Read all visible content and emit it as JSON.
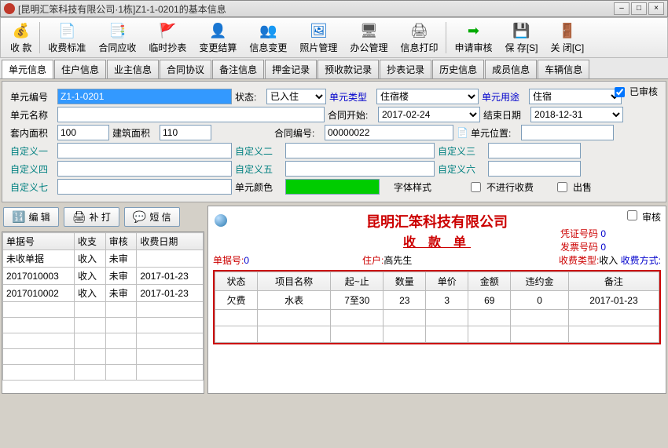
{
  "window": {
    "title": "[昆明汇笨科技有限公司·1栋]Z1-1-0201的基本信息"
  },
  "toolbar": [
    {
      "label": "收  款",
      "icon": "💰",
      "color": "#2a7"
    },
    {
      "label": "收费标准",
      "icon": "📄",
      "color": "#c33"
    },
    {
      "label": "合同应收",
      "icon": "📑",
      "color": "#06c"
    },
    {
      "label": "临时抄表",
      "icon": "🚩",
      "color": "#c33"
    },
    {
      "label": "变更结算",
      "icon": "👤",
      "color": "#f90"
    },
    {
      "label": "信息变更",
      "icon": "👥",
      "color": "#06c"
    },
    {
      "label": "照片管理",
      "icon": "🖼",
      "color": "#06c"
    },
    {
      "label": "办公管理",
      "icon": "🖥",
      "color": "#555"
    },
    {
      "label": "信息打印",
      "icon": "🖨",
      "color": "#555"
    },
    {
      "label": "申请审核",
      "icon": "➡",
      "color": "#0a0"
    },
    {
      "label": "保 存[S]",
      "icon": "💾",
      "color": "#339"
    },
    {
      "label": "关 闭[C]",
      "icon": "🚪",
      "color": "#c33"
    }
  ],
  "tabs": [
    "单元信息",
    "住户信息",
    "业主信息",
    "合同协议",
    "备注信息",
    "押金记录",
    "预收款记录",
    "抄表记录",
    "历史信息",
    "成员信息",
    "车辆信息"
  ],
  "active_tab": 0,
  "audited_label": "已审核",
  "form": {
    "unit_no": {
      "label": "单元编号",
      "value": "Z1-1-0201"
    },
    "state": {
      "label": "状态:",
      "value": "已入住"
    },
    "unit_type": {
      "label": "单元类型",
      "value": "住宿楼"
    },
    "unit_use": {
      "label": "单元用途",
      "value": "住宿"
    },
    "unit_name": {
      "label": "单元名称",
      "value": ""
    },
    "contract_start": {
      "label": "合同开始:",
      "value": "2017-02-24"
    },
    "end_date": {
      "label": "结束日期",
      "value": "2018-12-31"
    },
    "inner_area": {
      "label": "套内面积",
      "value": "100"
    },
    "build_area": {
      "label": "建筑面积",
      "value": "110"
    },
    "contract_no": {
      "label": "合同编号:",
      "value": "00000022"
    },
    "unit_pos": {
      "label": "单元位置:",
      "value": ""
    },
    "c1": {
      "label": "自定义一"
    },
    "c2": {
      "label": "自定义二"
    },
    "c3": {
      "label": "自定义三"
    },
    "c4": {
      "label": "自定义四"
    },
    "c5": {
      "label": "自定义五"
    },
    "c6": {
      "label": "自定义六"
    },
    "c7": {
      "label": "自定义七"
    },
    "unit_color": {
      "label": "单元颜色"
    },
    "font_style": {
      "label": "字体样式"
    },
    "no_charge": {
      "label": "不进行收费"
    },
    "for_sale": {
      "label": "出售"
    }
  },
  "left_buttons": {
    "edit": "编 辑",
    "reprint": "补 打",
    "sms": "短 信"
  },
  "left_grid": {
    "headers": [
      "单据号",
      "收支",
      "审核",
      "收费日期"
    ],
    "rows": [
      [
        "未收单据",
        "收入",
        "未审",
        ""
      ],
      [
        "2017010003",
        "收入",
        "未审",
        "2017-01-23"
      ],
      [
        "2017010002",
        "收入",
        "未审",
        "2017-01-23"
      ]
    ]
  },
  "receipt": {
    "company": "昆明汇笨科技有限公司",
    "title": "收  款  单",
    "audit_label": "审核",
    "voucher_label": "凭证号码",
    "voucher_val": "0",
    "invoice_label": "发票号码",
    "invoice_val": "0",
    "bill_no_label": "单据号:",
    "bill_no": "0",
    "tenant_label": "住户:",
    "tenant": "高先生",
    "charge_type_label": "收费类型:",
    "charge_type": "收入",
    "pay_method_label": "收费方式:",
    "pay_method": "",
    "headers": [
      "状态",
      "项目名称",
      "起~止",
      "数量",
      "单价",
      "金额",
      "违约金",
      "备注"
    ],
    "rows": [
      [
        "欠费",
        "水表",
        "7至30",
        "23",
        "3",
        "69",
        "0",
        "2017-01-23"
      ]
    ]
  }
}
